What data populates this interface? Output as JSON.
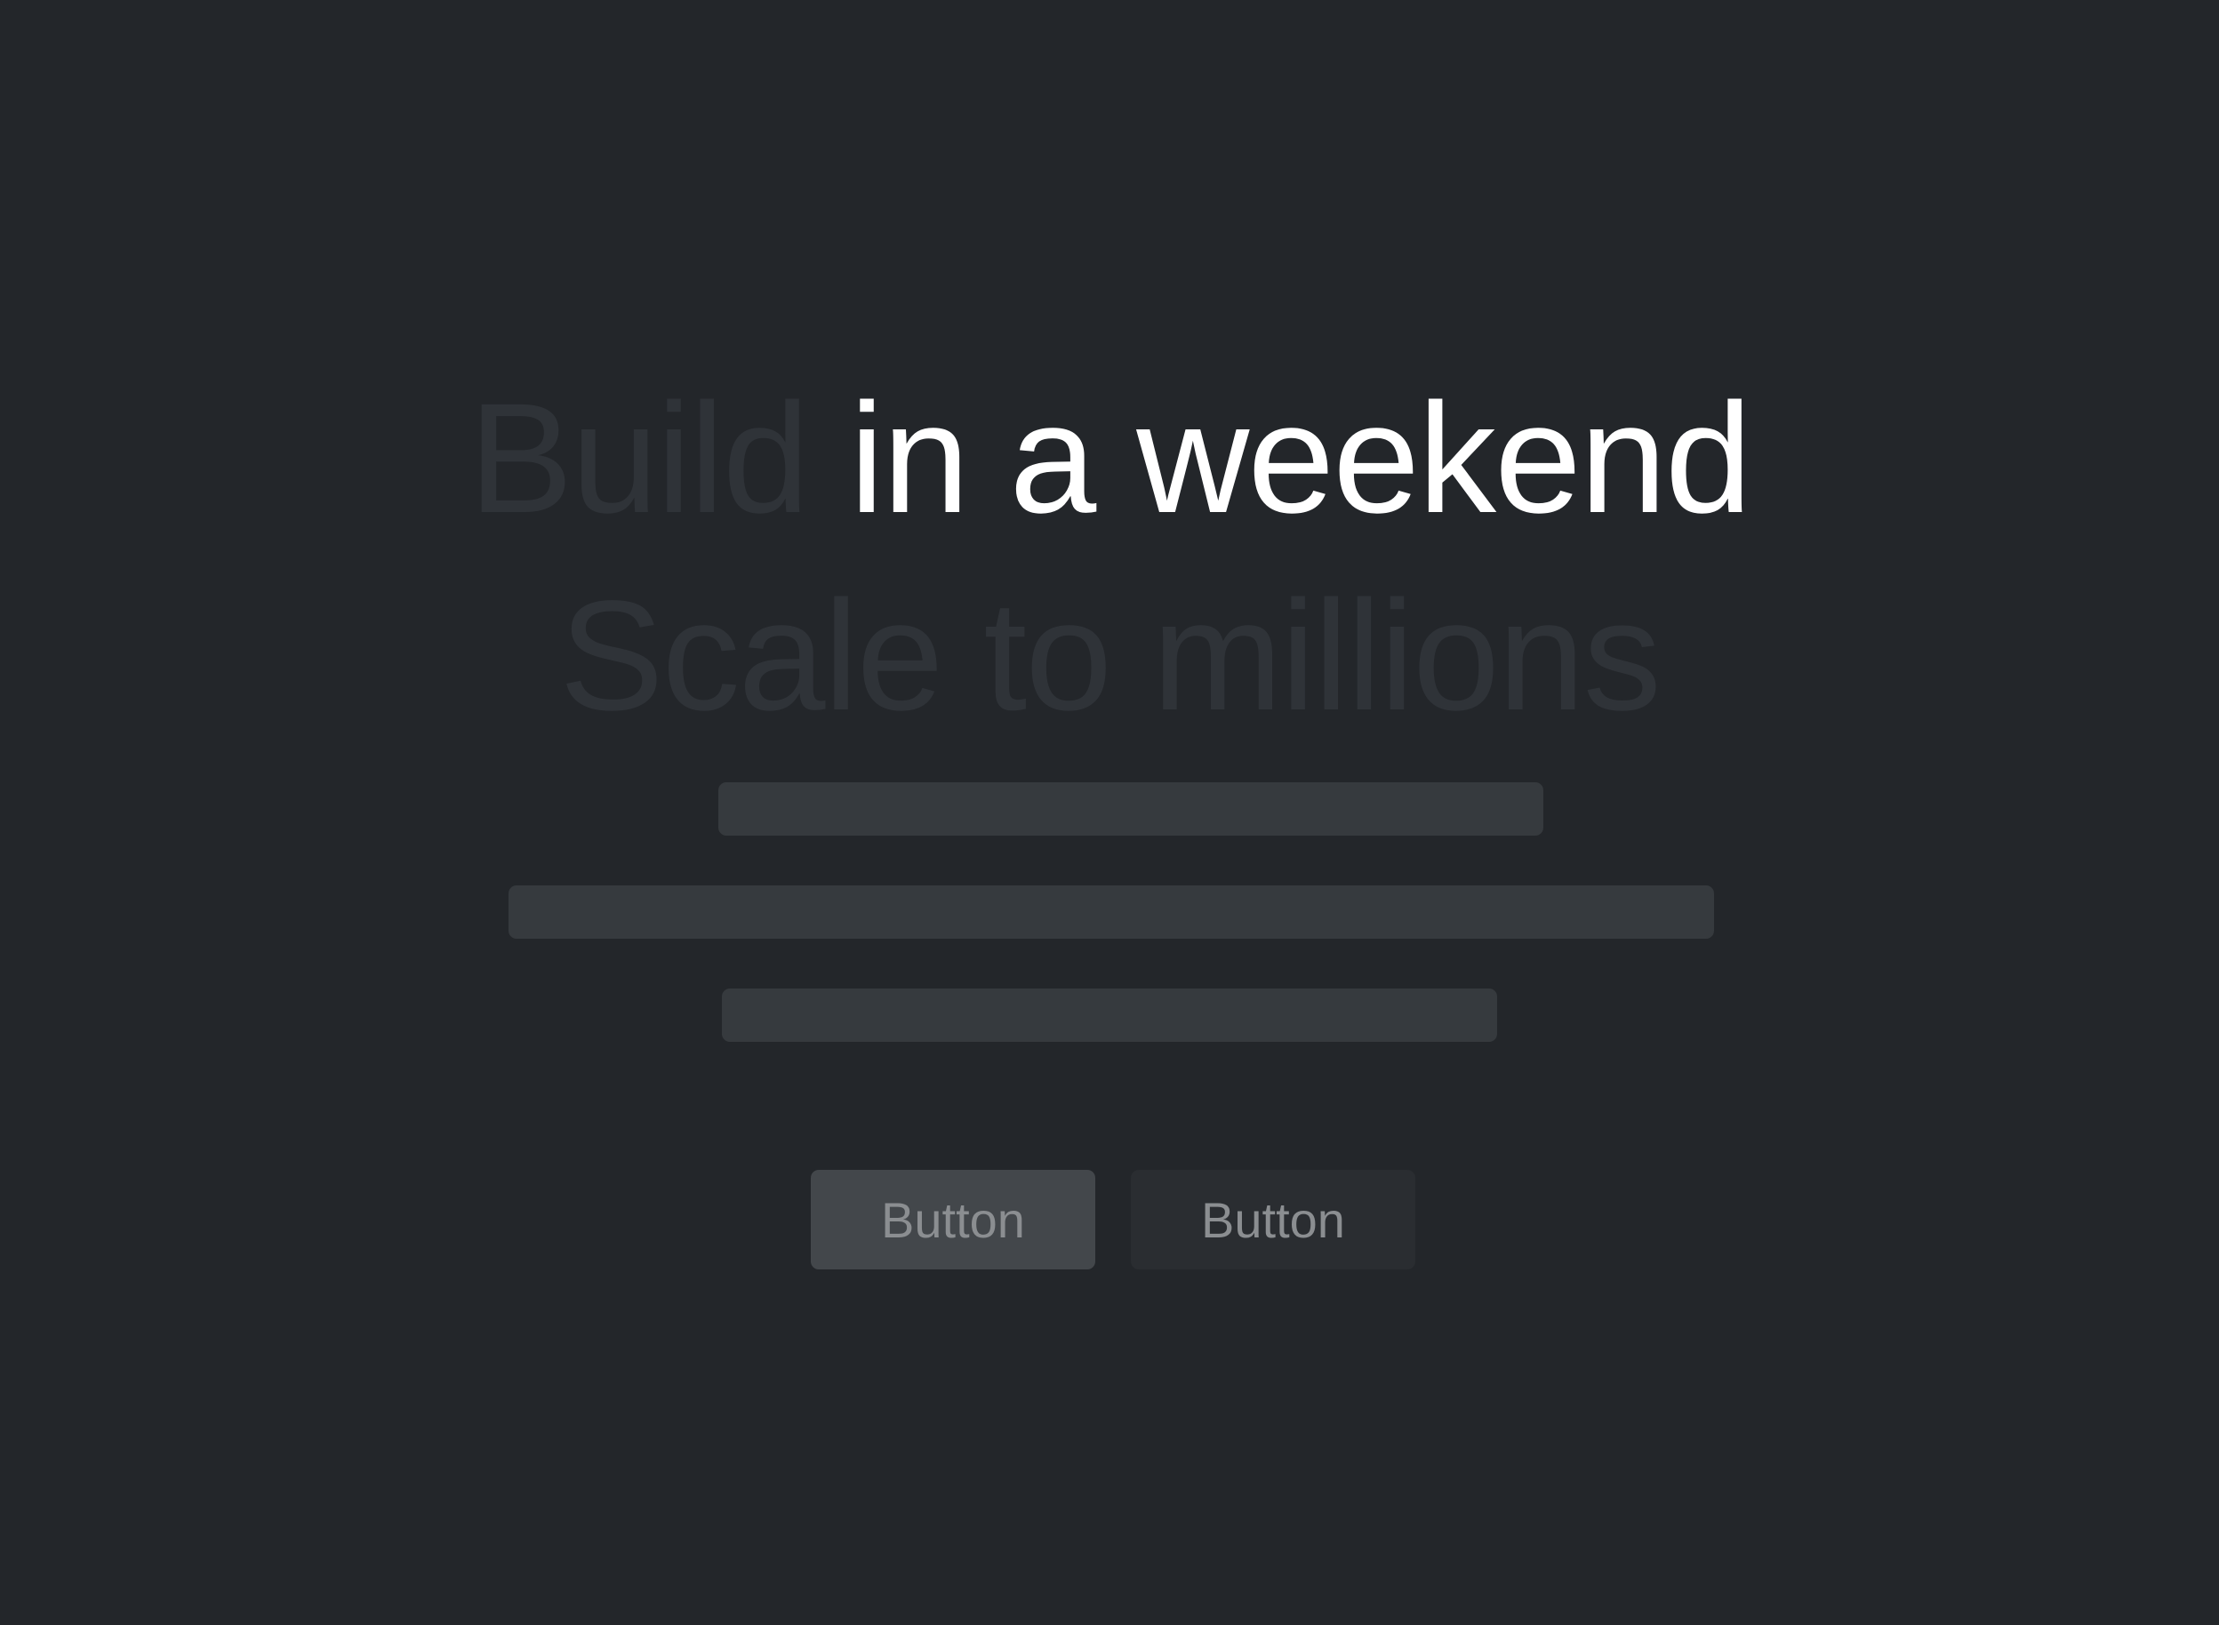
{
  "hero": {
    "headline_line1_dim": "Build",
    "headline_line1_bright": "in a weekend",
    "headline_line2": "Scale to millions"
  },
  "actions": {
    "primary_label": "Button",
    "secondary_label": "Button"
  },
  "colors": {
    "background": "#23262a",
    "headline_bright": "#ffffff",
    "headline_dim": "#2f3338",
    "skeleton": "#363a3e",
    "button_primary_bg": "#43474b",
    "button_secondary_bg": "#2a2d31",
    "button_text": "#8b8e91"
  }
}
